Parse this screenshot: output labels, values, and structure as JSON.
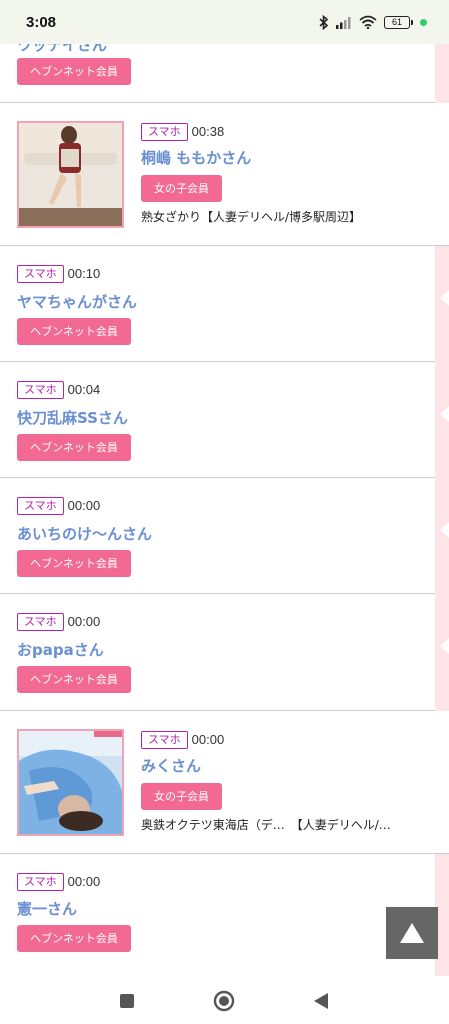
{
  "status_bar": {
    "time": "3:08",
    "battery": "61"
  },
  "feed": {
    "entries": [
      {
        "name": "ワッテイさん",
        "badge": "ヘブンネット会員"
      },
      {
        "device": "スマホ",
        "time": "00:38",
        "name": "桐嶋 ももかさん",
        "badge": "女の子会員",
        "shop": "熟女ざかり【人妻デリヘル/博多駅周辺】"
      },
      {
        "device": "スマホ",
        "time": "00:10",
        "name": "ヤマちゃんがさん",
        "badge": "ヘブンネット会員"
      },
      {
        "device": "スマホ",
        "time": "00:04",
        "name": "快刀乱麻SSさん",
        "badge": "ヘブンネット会員"
      },
      {
        "device": "スマホ",
        "time": "00:00",
        "name": "あいちのけ〜んさん",
        "badge": "ヘブンネット会員"
      },
      {
        "device": "スマホ",
        "time": "00:00",
        "name": "おpapaさん",
        "badge": "ヘブンネット会員"
      },
      {
        "device": "スマホ",
        "time": "00:00",
        "name": "みくさん",
        "badge": "女の子会員",
        "shop": "奥鉄オクテツ東海店（デ…　【人妻デリヘル/…"
      },
      {
        "device": "スマホ",
        "time": "00:00",
        "name": "憲一さん",
        "badge": "ヘブンネット会員"
      }
    ]
  },
  "icons": {
    "scroll_top": "triangle-up-icon",
    "nav": [
      "square-icon",
      "circle-icon",
      "triangle-back-icon"
    ]
  },
  "colors": {
    "badge_pink": "#f26a94",
    "name_blue": "#6a8fd2",
    "device_tag": "#b324a8",
    "side_pink": "#fde4e7"
  }
}
